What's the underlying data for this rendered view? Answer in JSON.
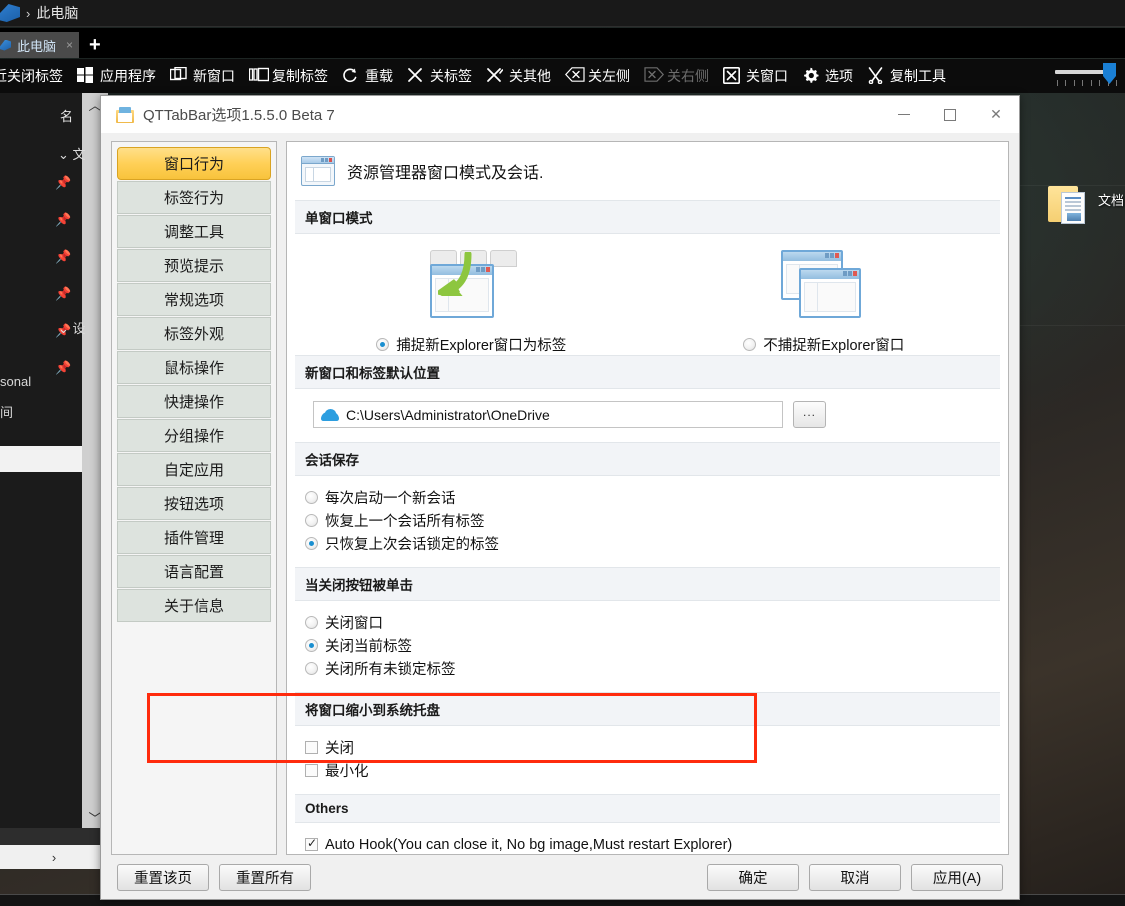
{
  "explorer": {
    "breadcrumb": "此电脑",
    "tab_label": "此电脑",
    "tab_close": "×",
    "new_tab": "+",
    "column_header": "名",
    "group1": "文",
    "group2": "设",
    "nav_text_1": "sonal",
    "nav_text_2": "间",
    "scroll_up": "︿",
    "scroll_down": "﹀",
    "hscroll_right": "›",
    "desktop_icon_label": "文档"
  },
  "qt_toolbar": {
    "items": [
      {
        "label": "近关闭标签",
        "icon": "recent-tabs-icon",
        "dim": false
      },
      {
        "label": "应用程序",
        "icon": "apps-icon",
        "dim": false
      },
      {
        "label": "新窗口",
        "icon": "new-window-icon",
        "dim": false
      },
      {
        "label": "复制标签",
        "icon": "clone-tab-icon",
        "dim": false
      },
      {
        "label": "重载",
        "icon": "reload-icon",
        "dim": false
      },
      {
        "label": "关标签",
        "icon": "close-tab-icon",
        "dim": false
      },
      {
        "label": "关其他",
        "icon": "close-others-icon",
        "dim": false
      },
      {
        "label": "关左侧",
        "icon": "close-left-icon",
        "dim": false
      },
      {
        "label": "关右侧",
        "icon": "close-right-icon",
        "dim": true
      },
      {
        "label": "关窗口",
        "icon": "close-window-icon",
        "dim": false
      },
      {
        "label": "选项",
        "icon": "gear-icon",
        "dim": false
      },
      {
        "label": "复制工具",
        "icon": "scissors-icon",
        "dim": false
      }
    ]
  },
  "dialog": {
    "title": "QTTabBar选项1.5.5.0 Beta 7",
    "window_controls": {
      "minimize": "–",
      "maximize": "□",
      "close": "✕"
    },
    "sidebar": {
      "items": [
        {
          "label": "窗口行为",
          "active": true
        },
        {
          "label": "标签行为",
          "active": false
        },
        {
          "label": "调整工具",
          "active": false
        },
        {
          "label": "预览提示",
          "active": false
        },
        {
          "label": "常规选项",
          "active": false
        },
        {
          "label": "标签外观",
          "active": false
        },
        {
          "label": "鼠标操作",
          "active": false
        },
        {
          "label": "快捷操作",
          "active": false
        },
        {
          "label": "分组操作",
          "active": false
        },
        {
          "label": "自定应用",
          "active": false
        },
        {
          "label": "按钮选项",
          "active": false
        },
        {
          "label": "插件管理",
          "active": false
        },
        {
          "label": "语言配置",
          "active": false
        },
        {
          "label": "关于信息",
          "active": false
        }
      ]
    },
    "panel": {
      "header_title": "资源管理器窗口模式及会话.",
      "sections": {
        "single_window_mode": {
          "heading": "单窗口模式",
          "options": [
            {
              "label": "捕捉新Explorer窗口为标签",
              "selected": true
            },
            {
              "label": "不捕捉新Explorer窗口",
              "selected": false
            }
          ]
        },
        "default_location": {
          "heading": "新窗口和标签默认位置",
          "path_value": "C:\\Users\\Administrator\\OneDrive",
          "browse_label": "..."
        },
        "session_save": {
          "heading": "会话保存",
          "options": [
            {
              "label": "每次启动一个新会话",
              "selected": false
            },
            {
              "label": "恢复上一个会话所有标签",
              "selected": false
            },
            {
              "label": "只恢复上次会话锁定的标签",
              "selected": true
            }
          ]
        },
        "close_button": {
          "heading": "当关闭按钮被单击",
          "options": [
            {
              "label": "关闭窗口",
              "selected": false
            },
            {
              "label": "关闭当前标签",
              "selected": true
            },
            {
              "label": "关闭所有未锁定标签",
              "selected": false
            }
          ]
        },
        "minimize_to_tray": {
          "heading": "将窗口缩小到系统托盘",
          "options": [
            {
              "label": "关闭",
              "checked": false
            },
            {
              "label": "最小化",
              "checked": false
            }
          ]
        },
        "others": {
          "heading": "Others",
          "options": [
            {
              "label": "Auto Hook(You can close it, No bg image,Must restart Explorer)",
              "checked": true
            }
          ]
        }
      }
    },
    "footer": {
      "reset_page": "重置该页",
      "reset_all": "重置所有",
      "ok": "确定",
      "cancel": "取消",
      "apply": "应用(A)"
    }
  },
  "colors": {
    "accent_highlight": "#ff2b0d",
    "sidebar_active": "#ffd057",
    "radio_dot": "#1a8fd0"
  }
}
